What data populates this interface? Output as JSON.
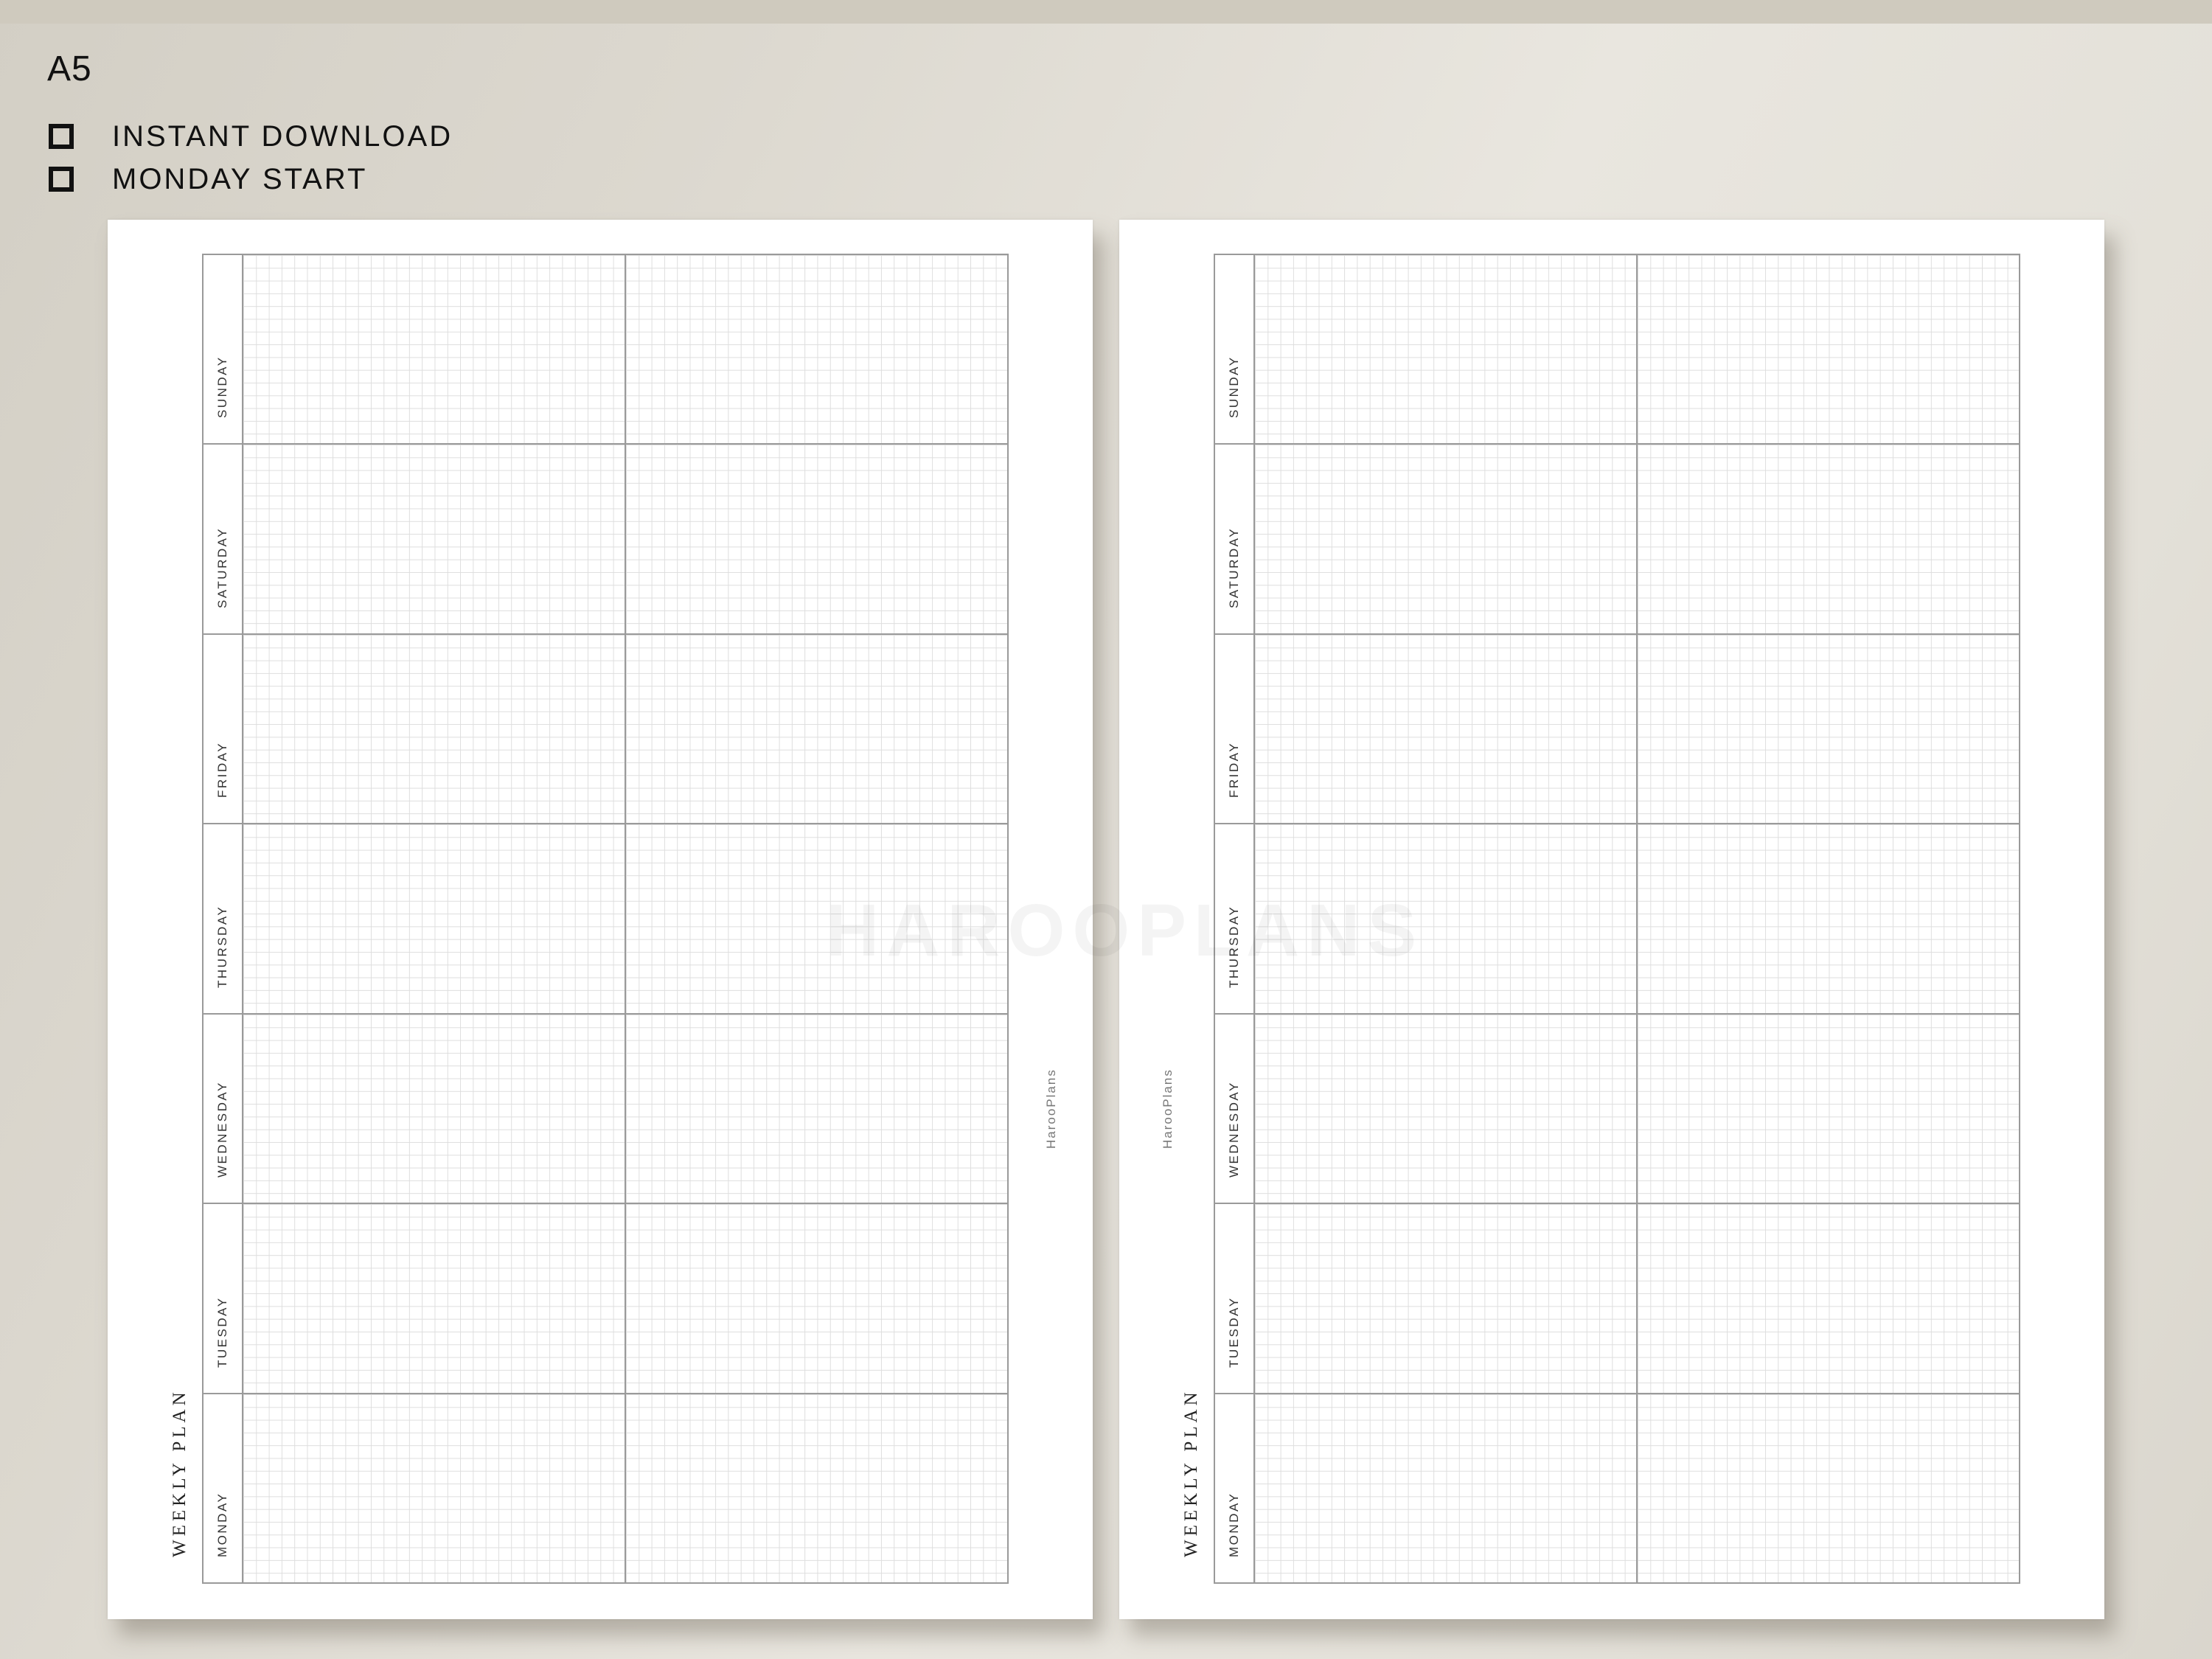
{
  "size_label": "A5",
  "features": [
    "INSTANT DOWNLOAD",
    "MONDAY START"
  ],
  "pages": [
    {
      "title": "WEEKLY PLAN",
      "brand": "HarooPlans",
      "days": [
        "SUNDAY",
        "SATURDAY",
        "FRIDAY",
        "THURSDAY",
        "WEDNESDAY",
        "TUESDAY",
        "MONDAY"
      ]
    },
    {
      "title": "WEEKLY PLAN",
      "brand": "HarooPlans",
      "days": [
        "SUNDAY",
        "SATURDAY",
        "FRIDAY",
        "THURSDAY",
        "WEDNESDAY",
        "TUESDAY",
        "MONDAY"
      ]
    }
  ],
  "watermark": "HAROOPLANS",
  "colors": {
    "background": "#e4e1d9",
    "page": "#ffffff",
    "grid_line": "#dedede",
    "frame_line": "#9a9a9a"
  },
  "icons": {
    "feature_bullet": "square-outline-icon"
  }
}
